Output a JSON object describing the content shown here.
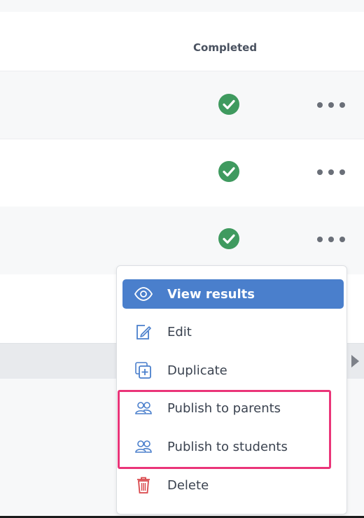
{
  "table": {
    "header": {
      "completed_label": "Completed"
    },
    "rows": [
      {
        "completed": true,
        "actions": "more"
      },
      {
        "completed": true,
        "actions": "more"
      },
      {
        "completed": true,
        "actions": "more"
      }
    ]
  },
  "context_menu": {
    "items": [
      {
        "label": "View results",
        "icon": "eye-icon",
        "active": true
      },
      {
        "label": "Edit",
        "icon": "edit-icon"
      },
      {
        "label": "Duplicate",
        "icon": "duplicate-icon"
      },
      {
        "label": "Publish to parents",
        "icon": "users-icon"
      },
      {
        "label": "Publish to students",
        "icon": "users-icon"
      },
      {
        "label": "Delete",
        "icon": "trash-icon"
      }
    ]
  },
  "colors": {
    "accent": "#4a7fcc",
    "success": "#3f9a5f",
    "danger": "#d9474b",
    "highlight": "#ea3579"
  }
}
